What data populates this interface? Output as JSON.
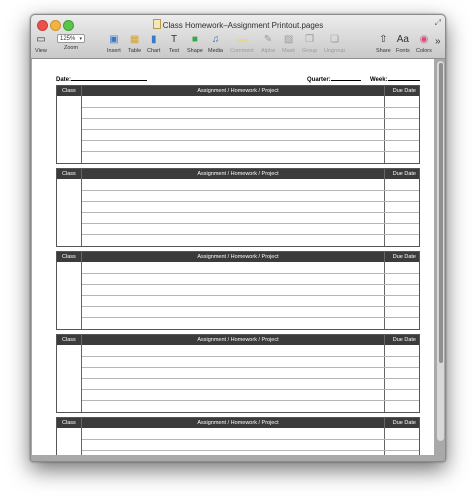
{
  "window": {
    "title": "Class Homework–Assignment Printout.pages"
  },
  "toolbar": {
    "view": "View",
    "zoom_value": "125%",
    "zoom": "Zoom",
    "insert": "Insert",
    "table": "Table",
    "chart": "Chart",
    "text": "Text",
    "shape": "Shape",
    "media": "Media",
    "comment": "Comment",
    "alpha": "Alpha",
    "mask": "Mask",
    "group": "Group",
    "ungroup": "Ungroup",
    "share": "Share",
    "fonts": "Fonts",
    "colors": "Colors",
    "more": "»"
  },
  "form": {
    "date_label": "Date:",
    "quarter_label": "Quarter:",
    "week_label": "Week:"
  },
  "table_header": {
    "class": "Class",
    "assignment": "Assignment / Homework / Project",
    "due": "Due Date"
  },
  "colors": {
    "header_bar": "#3b3b3b",
    "window_chrome": "#a9a9a9"
  }
}
